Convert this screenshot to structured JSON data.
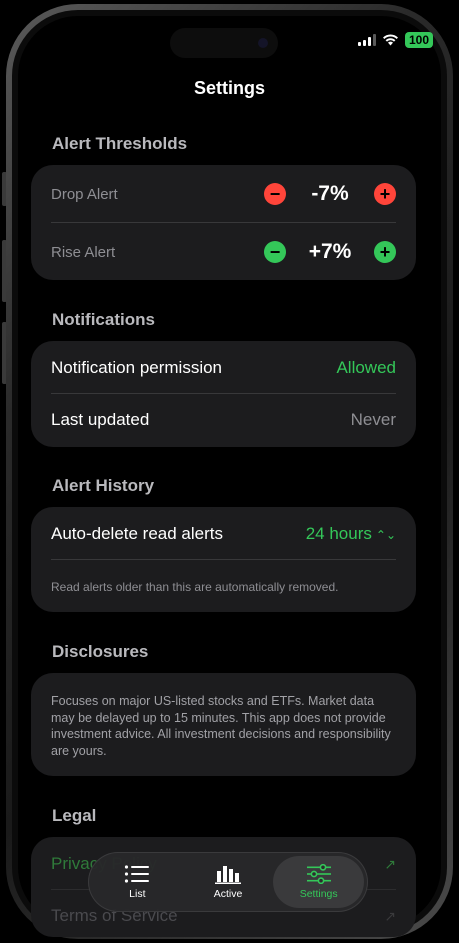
{
  "status_bar": {
    "battery": "100"
  },
  "nav": {
    "title": "Settings"
  },
  "alert_thresholds": {
    "header": "Alert Thresholds",
    "drop": {
      "label": "Drop Alert",
      "value": "-7%",
      "color": "#ff453a"
    },
    "rise": {
      "label": "Rise Alert",
      "value": "+7%",
      "color": "#34c759"
    }
  },
  "notifications": {
    "header": "Notifications",
    "permission": {
      "label": "Notification permission",
      "value": "Allowed"
    },
    "last_updated": {
      "label": "Last updated",
      "value": "Never"
    }
  },
  "alert_history": {
    "header": "Alert History",
    "auto_delete": {
      "label": "Auto-delete read alerts",
      "value": "24 hours"
    },
    "footnote": "Read alerts older than this are automatically removed."
  },
  "disclosures": {
    "header": "Disclosures",
    "text": "Focuses on major US-listed stocks and ETFs. Market data may be delayed up to 15 minutes. This app does not provide investment advice. All investment decisions and responsibility are yours."
  },
  "legal": {
    "header": "Legal",
    "items": [
      {
        "label": "Privacy Policy"
      },
      {
        "label": "Terms of Service"
      }
    ]
  },
  "tabbar": {
    "tabs": [
      {
        "label": "List",
        "icon": "list-icon"
      },
      {
        "label": "Active",
        "icon": "bar-chart-icon"
      },
      {
        "label": "Settings",
        "icon": "sliders-icon",
        "active": true
      }
    ]
  },
  "colors": {
    "accent": "#34c759",
    "danger": "#ff453a",
    "card": "#1c1c1e"
  }
}
